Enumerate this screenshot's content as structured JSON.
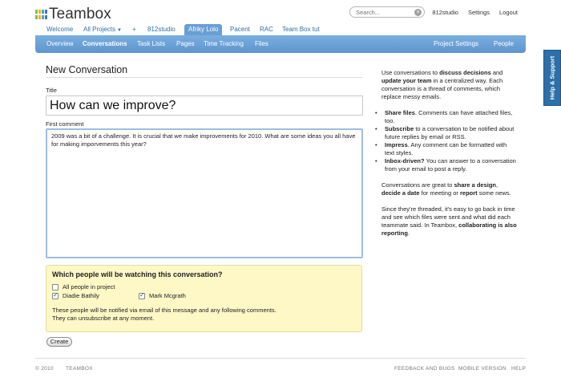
{
  "header": {
    "logo_text": "Teambox",
    "logo_colors": [
      "#7cc24a",
      "#f2b134",
      "#52a3d9",
      "#3b7cc4"
    ],
    "search_placeholder": "Search...",
    "user_link": "812studio",
    "settings_link": "Settings",
    "logout_link": "Logout"
  },
  "project_tabs": [
    "Welcome",
    "All Projects",
    "+",
    "812studio",
    "Afriky Lolo",
    "Pacent",
    "RAC",
    "Team Box tut"
  ],
  "active_project_tab": "Afriky Lolo",
  "subnav": {
    "tabs": [
      "Overview",
      "Conversations",
      "Task Lists",
      "Pages",
      "Time Tracking",
      "Files"
    ],
    "active": "Conversations",
    "right_links": [
      "Project Settings",
      "People"
    ]
  },
  "form": {
    "page_title": "New Conversation",
    "title_label": "Title",
    "title_value": "How can we improve?",
    "comment_label": "First comment",
    "comment_value": "2009 was a bit of a challenge. It is crucial that we make improvements for 2010. What are some ideas you all have for making imporvements this year?",
    "watch_title": "Which people will be watching this conversation?",
    "watchers": [
      {
        "label": "All people in project",
        "checked": false
      },
      {
        "label": "Diadie Bathily",
        "checked": true
      },
      {
        "label": "Mark Mcgrath",
        "checked": true
      }
    ],
    "watch_note_1": "These people will be notified via email of this message and any following comments.",
    "watch_note_2": "They can unsubscribe at any moment.",
    "create_button": "Create"
  },
  "sidebar": {
    "intro_a": "Use conversations to ",
    "intro_b": "discuss decisions",
    "intro_c": " and ",
    "intro_d": "update your team",
    "intro_e": " in a centralized way. Each conversation is a thread of comments, which replace messy emails.",
    "bullets": [
      {
        "bold": "Share files",
        "text": ". Comments can have attached files, too."
      },
      {
        "bold": "Subscribe",
        "text": " to a conversation to be notified about future replies by email or RSS."
      },
      {
        "bold": "Impress",
        "text": ". Any comment can be formatted with text styles."
      },
      {
        "bold": "Inbox-driven?",
        "text": " You can answer to a conversation from your email to post a reply."
      }
    ],
    "p2_a": "Conversations are great to ",
    "p2_b": "share a design",
    "p2_c": ", ",
    "p2_d": "decide a date",
    "p2_e": " for meeting or ",
    "p2_f": "report",
    "p2_g": " some news.",
    "p3_a": "Since they're threaded, it's easy to go back in time and see which files were sent and what did each teammate said. In Teambox, ",
    "p3_b": "collaborating is also reporting",
    "p3_c": "."
  },
  "help_tab": "Help & Support",
  "footer": {
    "copyright": "© 2010",
    "brand": "TEAMBOX",
    "links": [
      "FEEDBACK AND BUGS",
      "MOBILE VERSION",
      "HELP"
    ]
  }
}
